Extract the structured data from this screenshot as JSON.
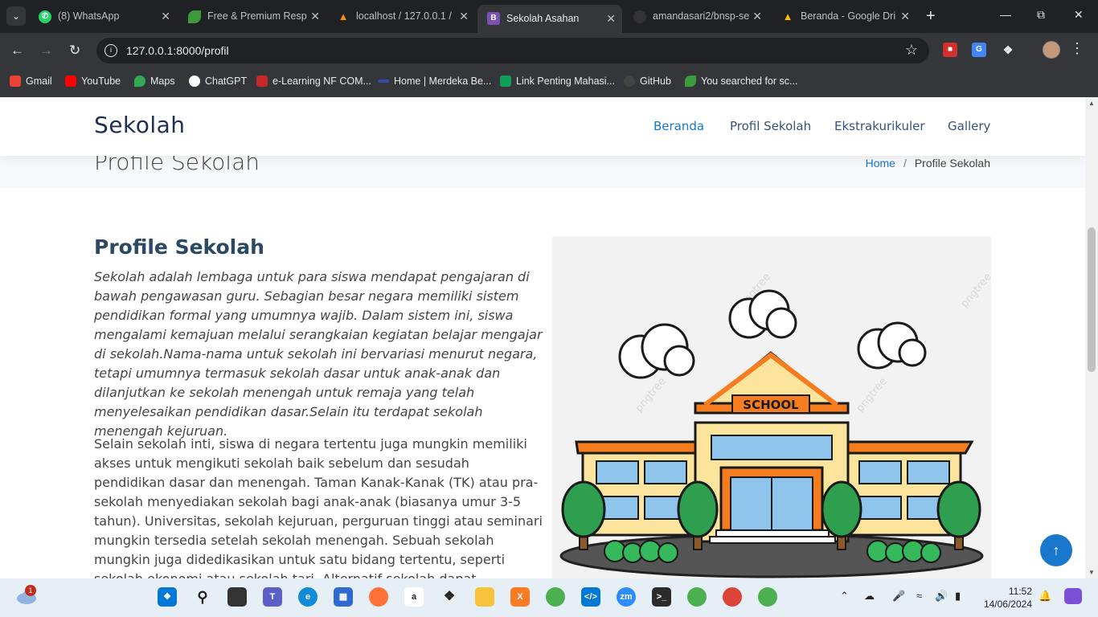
{
  "browser": {
    "tabs": [
      {
        "title": "(8) WhatsApp",
        "icon": "whatsapp-icon",
        "color": "#25d366"
      },
      {
        "title": "Free & Premium Resp",
        "icon": "leaf-icon",
        "color": "#3c9a3c"
      },
      {
        "title": "localhost / 127.0.0.1 /",
        "icon": "phpmyadmin-icon",
        "color": "#f29111"
      },
      {
        "title": "Sekolah Asahan",
        "icon": "bootstrap-icon",
        "color": "#7952b3",
        "active": true
      },
      {
        "title": "amandasari2/bnsp-se",
        "icon": "github-icon",
        "color": "#333333"
      },
      {
        "title": "Beranda - Google Dri",
        "icon": "google-drive-icon",
        "color": "#1fa463"
      }
    ],
    "url": "127.0.0.1:8000/profil",
    "bookmarks": [
      {
        "label": "Gmail",
        "icon": "gmail-icon",
        "color": "#ea4335"
      },
      {
        "label": "YouTube",
        "icon": "youtube-icon",
        "color": "#ff0000"
      },
      {
        "label": "Maps",
        "icon": "maps-icon",
        "color": "#34a853"
      },
      {
        "label": "ChatGPT",
        "icon": "chatgpt-icon",
        "color": "#ffffff"
      },
      {
        "label": "e-Learning NF COM...",
        "icon": "elearning-icon",
        "color": "#c62828"
      },
      {
        "label": "Home | Merdeka Be...",
        "icon": "merdeka-icon",
        "color": "#3949ab"
      },
      {
        "label": "Link Penting Mahasi...",
        "icon": "sheets-icon",
        "color": "#0f9d58"
      },
      {
        "label": "GitHub",
        "icon": "github-icon",
        "color": "#444444"
      },
      {
        "label": "You searched for sc...",
        "icon": "leaf-icon",
        "color": "#3c9a3c"
      }
    ]
  },
  "site": {
    "logo": "Sekolah",
    "nav": [
      {
        "label": "Beranda",
        "active": true
      },
      {
        "label": "Profil Sekolah",
        "active": false
      },
      {
        "label": "Ekstrakurikuler",
        "active": false
      },
      {
        "label": "Gallery",
        "active": false
      }
    ],
    "breadcrumb_title": "Profile Sekolah",
    "breadcrumb_home": "Home",
    "breadcrumb_sep": "/",
    "breadcrumb_current": "Profile Sekolah",
    "about_title": "Profile Sekolah",
    "para1": "Sekolah adalah lembaga untuk para siswa mendapat pengajaran di bawah pengawasan guru. Sebagian besar negara memiliki sistem pendidikan formal yang umumnya wajib. Dalam sistem ini, siswa mengalami kemajuan melalui serangkaian kegiatan belajar mengajar di sekolah.Nama-nama untuk sekolah ini bervariasi menurut negara, tetapi umumnya termasuk sekolah dasar untuk anak-anak dan dilanjutkan ke sekolah menengah untuk remaja yang telah menyelesaikan pendidikan dasar.Selain itu terdapat sekolah menengah kejuruan.",
    "para2": "Selain sekolah inti, siswa di negara tertentu juga mungkin memiliki akses untuk mengikuti sekolah baik sebelum dan sesudah pendidikan dasar dan menengah. Taman Kanak-Kanak (TK) atau pra-sekolah menyediakan sekolah bagi anak-anak (biasanya umur 3-5 tahun). Universitas, sekolah kejuruan, perguruan tinggi atau seminari mungkin tersedia setelah sekolah menengah. Sebuah sekolah mungkin juga didedikasikan untuk satu bidang tertentu, seperti sekolah ekonomi atau sekolah tari. Alternatif sekolah dapat menyediakan kurikulum dan metode non",
    "school_sign": "SCHOOL",
    "watermark": "pngtree",
    "accent": "#1977cc"
  },
  "taskbar": {
    "weather_badge": "1",
    "time": "11:52",
    "date": "14/06/2024"
  }
}
